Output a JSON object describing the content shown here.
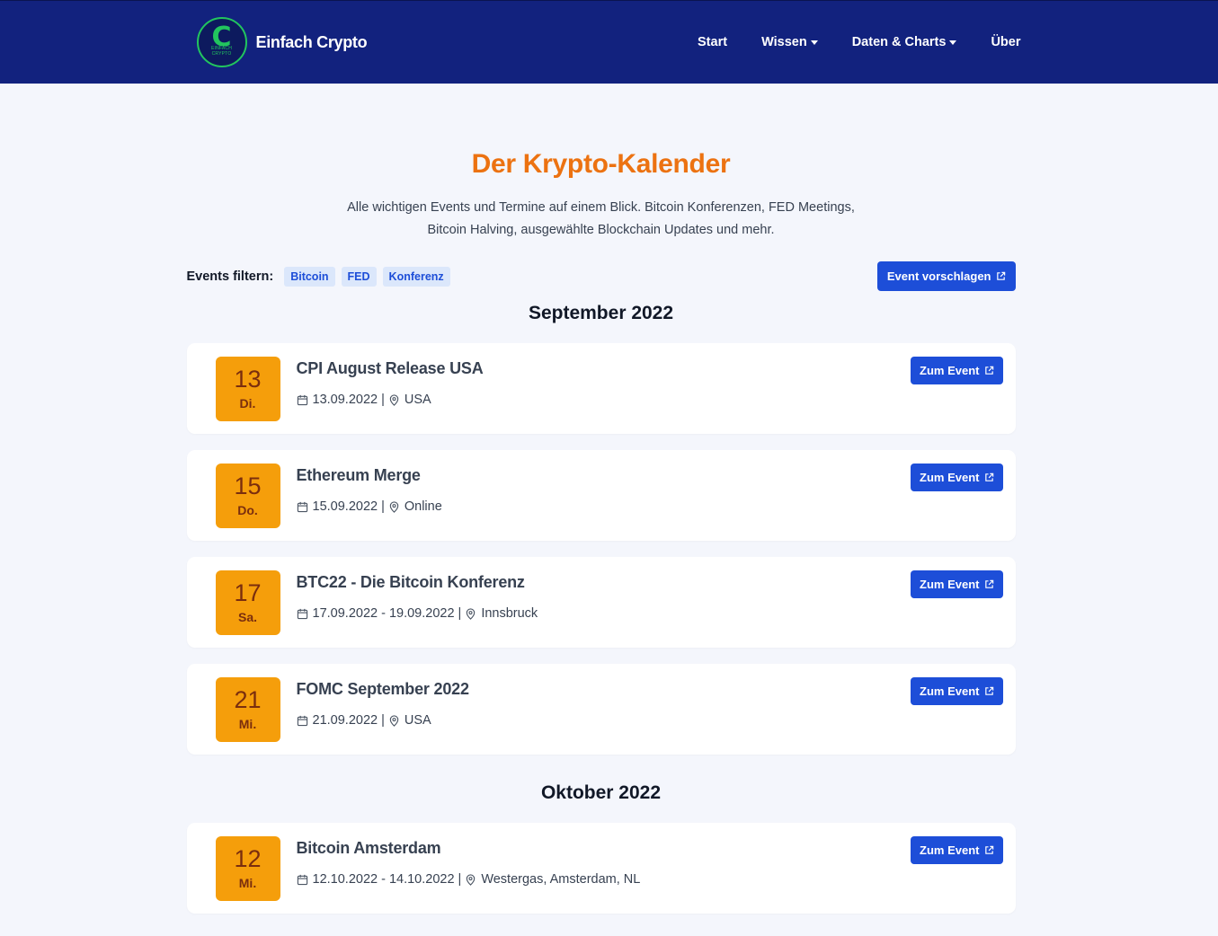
{
  "header": {
    "logo_letter": "C",
    "logo_sub_1": "EINFACH",
    "logo_sub_2": "CRYPTO",
    "brand": "Einfach Crypto",
    "nav": [
      "Start",
      "Wissen",
      "Daten & Charts",
      "Über"
    ]
  },
  "page": {
    "title": "Der Krypto-Kalender",
    "intro_line1": "Alle wichtigen Events und Termine auf einem Blick. Bitcoin Konferenzen, FED Meetings,",
    "intro_line2": "Bitcoin Halving, ausgewählte Blockchain Updates und mehr."
  },
  "filter": {
    "label": "Events filtern:",
    "chips": [
      "Bitcoin",
      "FED",
      "Konferenz"
    ],
    "suggest_button": "Event vorschlagen"
  },
  "months": [
    {
      "name": "September 2022",
      "events": [
        {
          "day": "13",
          "weekday": "Di.",
          "title": "CPI August Release USA",
          "date": "13.09.2022",
          "location": "USA",
          "button": "Zum Event"
        },
        {
          "day": "15",
          "weekday": "Do.",
          "title": "Ethereum Merge",
          "date": "15.09.2022",
          "location": "Online",
          "button": "Zum Event"
        },
        {
          "day": "17",
          "weekday": "Sa.",
          "title": "BTC22 - Die Bitcoin Konferenz",
          "date": "17.09.2022 - 19.09.2022",
          "location": "Innsbruck",
          "button": "Zum Event"
        },
        {
          "day": "21",
          "weekday": "Mi.",
          "title": "FOMC September 2022",
          "date": "21.09.2022",
          "location": "USA",
          "button": "Zum Event"
        }
      ]
    },
    {
      "name": "Oktober 2022",
      "events": [
        {
          "day": "12",
          "weekday": "Mi.",
          "title": "Bitcoin Amsterdam",
          "date": "12.10.2022 - 14.10.2022",
          "location": "Westergas, Amsterdam, NL",
          "button": "Zum Event"
        }
      ]
    }
  ],
  "meta_separator": "|",
  "colors": {
    "navbar": "#12227e",
    "title_orange": "#ec7211",
    "date_badge": "#f59e0b",
    "button_blue": "#1d4ed8",
    "logo_green": "#22c55e"
  },
  "icons": {
    "calendar": "calendar-icon",
    "location": "map-pin-icon",
    "external": "external-link-icon"
  }
}
